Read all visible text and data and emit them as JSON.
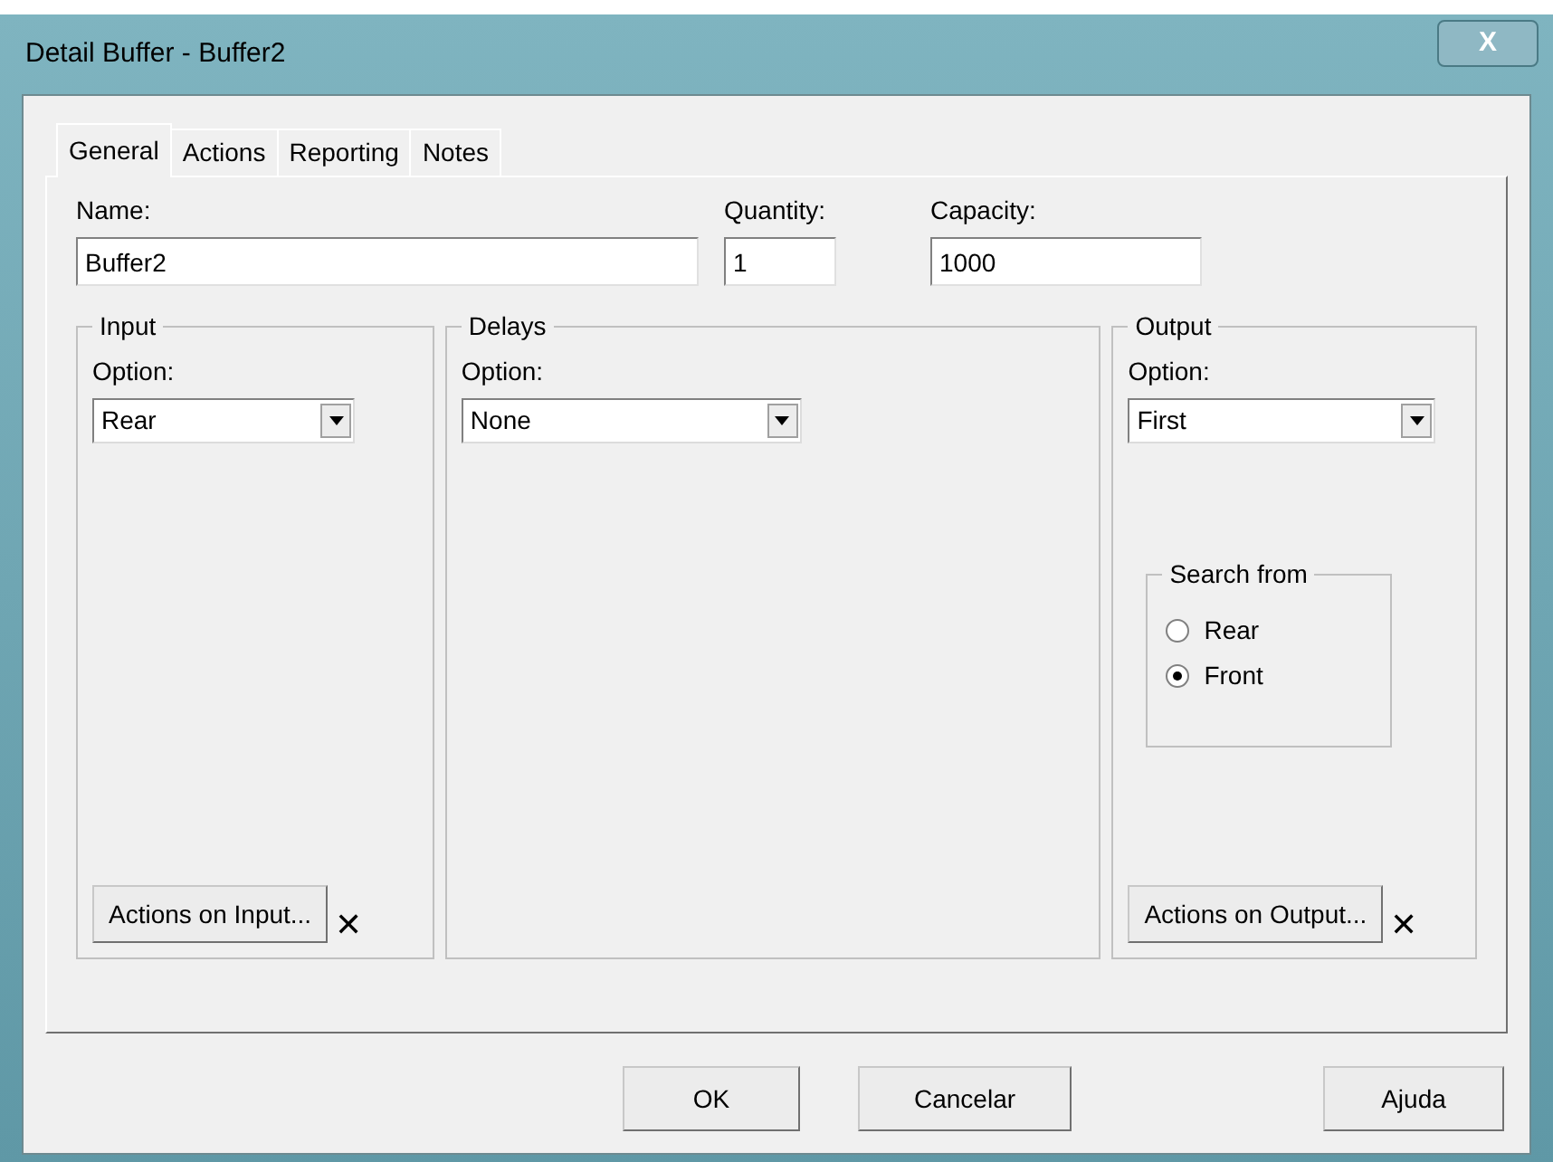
{
  "window": {
    "title": "Detail Buffer - Buffer2",
    "close": "X"
  },
  "tabs": [
    {
      "label": "General",
      "selected": true
    },
    {
      "label": "Actions",
      "selected": false
    },
    {
      "label": "Reporting",
      "selected": false
    },
    {
      "label": "Notes",
      "selected": false
    }
  ],
  "fields": [
    {
      "label": "Name:",
      "value": "Buffer2"
    },
    {
      "label": "Quantity:",
      "value": "1"
    },
    {
      "label": "Capacity:",
      "value": "1000"
    }
  ],
  "input": {
    "title": "Input",
    "option_label": "Option:",
    "option": "Rear",
    "action_button": "Actions on Input...",
    "clear": "✕"
  },
  "delays": {
    "title": "Delays",
    "option_label": "Option:",
    "option": "None"
  },
  "output": {
    "title": "Output",
    "option_label": "Option:",
    "option": "First",
    "search_title": "Search from",
    "search_options": [
      {
        "label": "Rear",
        "selected": false
      },
      {
        "label": "Front",
        "selected": true
      }
    ],
    "action_button": "Actions on Output...",
    "clear": "✕"
  },
  "buttons": [
    "OK",
    "Cancelar",
    "Ajuda"
  ]
}
